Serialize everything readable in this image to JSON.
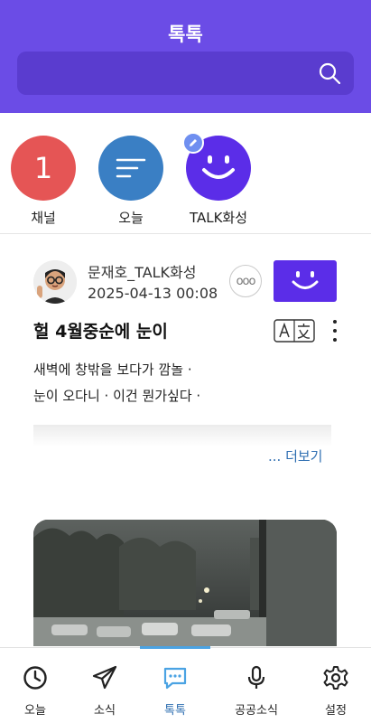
{
  "header": {
    "title": "톡톡",
    "search_icon": "search-icon",
    "background": "#6b4ce6"
  },
  "channels": [
    {
      "label": "채널",
      "badge": "1",
      "color": "#e55555"
    },
    {
      "label": "오늘",
      "icon": "list-lines-icon",
      "color": "#3a7fc4"
    },
    {
      "label": "TALK화성",
      "icon": "smile-face-icon",
      "color": "#5b2de8"
    }
  ],
  "post": {
    "author": "문재호_TALK화성",
    "date": "2025-04-13 00:08",
    "title": "헐 4월중순에 눈이",
    "body_line1": "새벽에 창밖을 보다가 깜놀 ·",
    "body_line2": "눈이 오다니 · 이건 뭔가싶다 ·",
    "read_more": "... 더보기",
    "more_bubble": "ooo"
  },
  "nav": {
    "items": [
      {
        "label": "오늘",
        "icon": "clock-icon"
      },
      {
        "label": "소식",
        "icon": "paper-plane-icon"
      },
      {
        "label": "톡톡",
        "icon": "chat-bubble-icon",
        "active": true
      },
      {
        "label": "공공소식",
        "icon": "microphone-icon"
      },
      {
        "label": "설정",
        "icon": "gear-icon"
      }
    ],
    "active_color": "#2f6fb2"
  }
}
